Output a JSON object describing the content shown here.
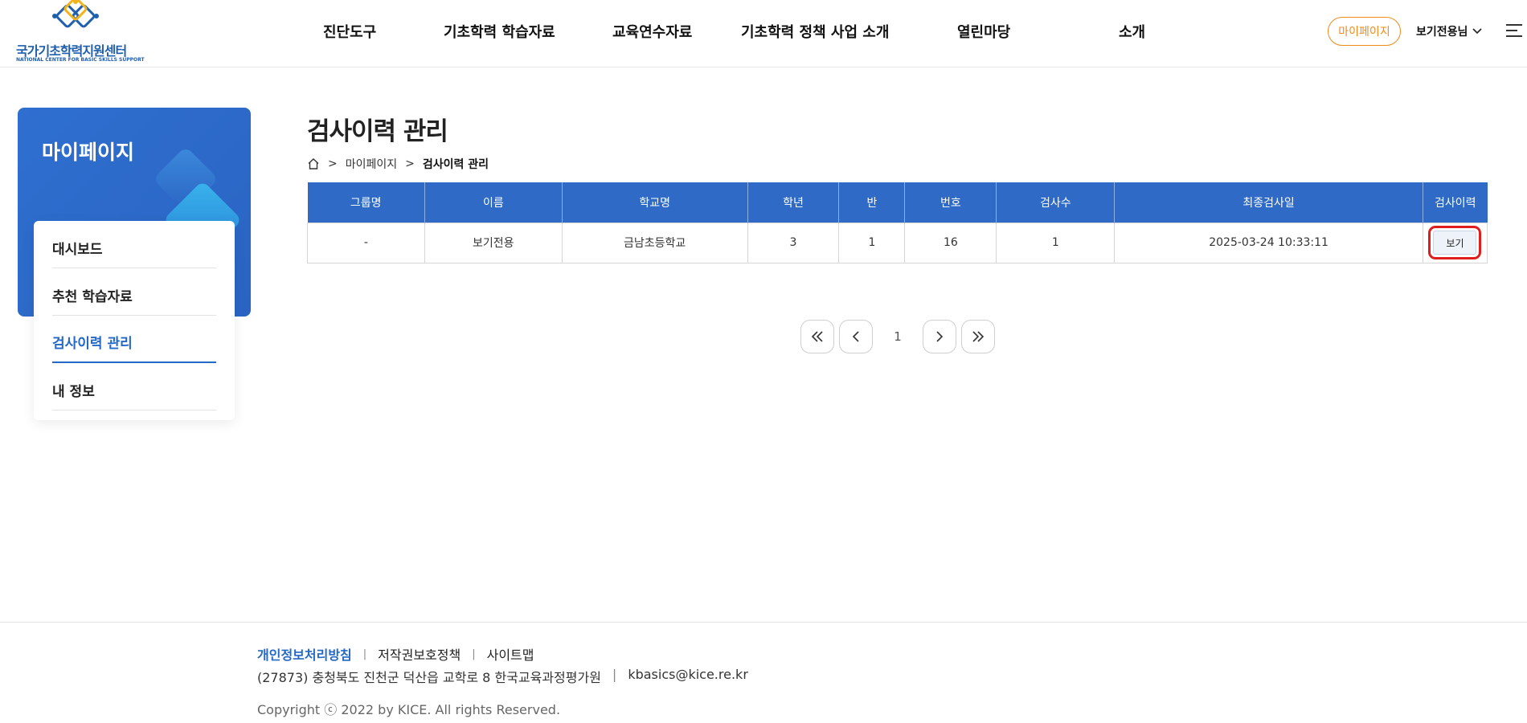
{
  "header": {
    "logo_kr": "국가기초학력지원센터",
    "logo_en": "NATIONAL CENTER FOR BASIC SKILLS SUPPORT",
    "nav": [
      "진단도구",
      "기초학력 학습자료",
      "교육연수자료",
      "기초학력 정책 사업 소개",
      "열린마당",
      "소개"
    ],
    "mypage_label": "마이페이지",
    "user_label": "보기전용님"
  },
  "sidebar": {
    "title": "마이페이지",
    "items": [
      {
        "label": "대시보드"
      },
      {
        "label": "추천 학습자료"
      },
      {
        "label": "검사이력 관리"
      },
      {
        "label": "내 정보"
      }
    ],
    "active_index": 2
  },
  "main": {
    "title": "검사이력 관리",
    "breadcrumb": [
      "마이페이지",
      "검사이력 관리"
    ],
    "table": {
      "headers": [
        "그룹명",
        "이름",
        "학교명",
        "학년",
        "반",
        "번호",
        "검사수",
        "최종검사일",
        "검사이력"
      ],
      "rows": [
        [
          "-",
          "보기전용",
          "금남초등학교",
          "3",
          "1",
          "16",
          "1",
          "2025-03-24 10:33:11"
        ]
      ],
      "view_label": "보기"
    },
    "pagination": {
      "current": "1"
    }
  },
  "footer": {
    "links": [
      "개인정보처리방침",
      "저작권보호정책",
      "사이트맵"
    ],
    "address": "(27873) 충청북도 진천군 덕산읍 교학로 8 한국교육과정평가원",
    "email": "kbasics@kice.re.kr",
    "copyright": "Copyright ⓒ 2022 by KICE. All rights Reserved."
  },
  "colors": {
    "primary": "#2f6bc6",
    "accent": "#f08a1c",
    "highlight": "#e01d1d"
  }
}
